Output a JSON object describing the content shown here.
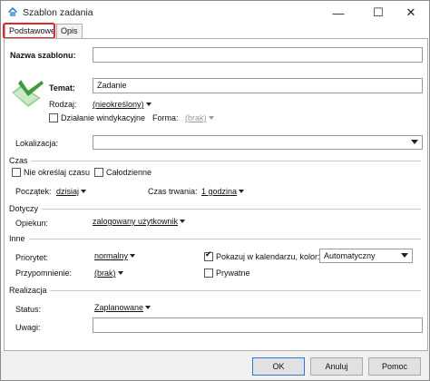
{
  "window": {
    "title": "Szablon zadania",
    "icon": "app-icon",
    "minimize": "—",
    "maximize": "☐",
    "close": "✕"
  },
  "tabs": [
    {
      "label": "Podstawowe",
      "active": true
    },
    {
      "label": "Opis",
      "active": false
    }
  ],
  "form": {
    "template_name_label": "Nazwa szablonu:",
    "template_name_value": "",
    "topic_label": "Temat:",
    "topic_value": "Zadanie",
    "kind_label": "Rodzaj:",
    "kind_value": "(nieokreślony)",
    "collection_action_label": "Działanie windykacyjne",
    "collection_action_checked": false,
    "form_label": "Forma:",
    "form_value": "(brak)",
    "location_label": "Lokalizacja:",
    "location_value": ""
  },
  "time": {
    "section": "Czas",
    "unspecified_label": "Nie określaj czasu",
    "unspecified_checked": false,
    "all_day_label": "Całodzienne",
    "all_day_checked": false,
    "start_label": "Początek:",
    "start_value": "dzisiaj",
    "duration_label": "Czas trwania:",
    "duration_value": "1 godzina"
  },
  "concerns": {
    "section": "Dotyczy",
    "caretaker_label": "Opiekun:",
    "caretaker_value": "zalogowany użytkownik"
  },
  "other": {
    "section": "Inne",
    "priority_label": "Priorytet:",
    "priority_value": "normalny",
    "show_calendar_label": "Pokazuj w kalendarzu, kolor:",
    "show_calendar_checked": true,
    "color_value": "Automatyczny",
    "reminder_label": "Przypomnienie:",
    "reminder_value": "(brak)",
    "private_label": "Prywatne",
    "private_checked": false
  },
  "realization": {
    "section": "Realizacja",
    "status_label": "Status:",
    "status_value": "Zaplanowane",
    "notes_label": "Uwagi:",
    "notes_value": ""
  },
  "buttons": {
    "ok": "OK",
    "cancel": "Anuluj",
    "help": "Pomoc"
  },
  "colors": {
    "highlight": "#e0262f",
    "icon_green": "#4caf50",
    "default_button_border": "#2c7bd6"
  }
}
